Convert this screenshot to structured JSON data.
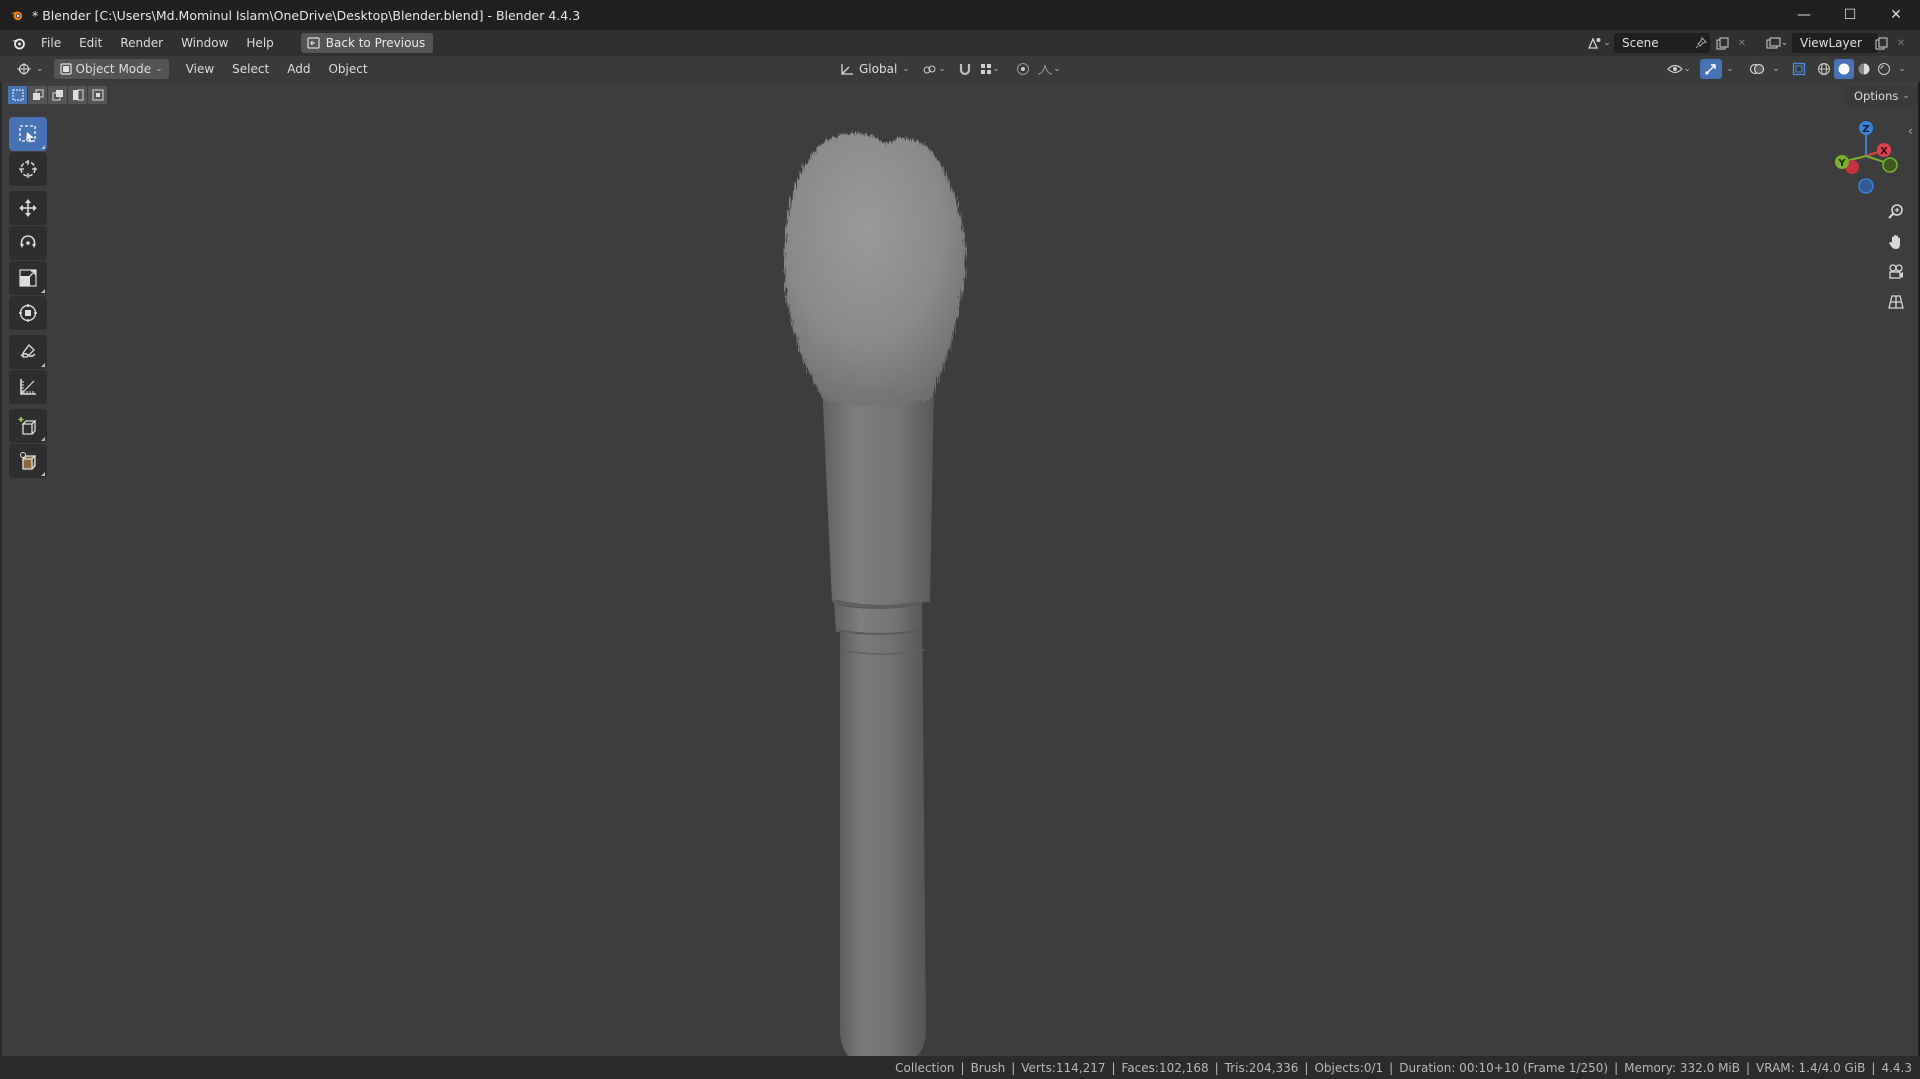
{
  "window": {
    "title": "* Blender [C:\\Users\\Md.Mominul Islam\\OneDrive\\Desktop\\Blender.blend] - Blender 4.4.3",
    "minimize": "—",
    "maximize": "☐",
    "close": "✕"
  },
  "topbar": {
    "menus": [
      "File",
      "Edit",
      "Render",
      "Window",
      "Help"
    ],
    "back_label": "Back to Previous",
    "scene_label": "Scene",
    "viewlayer_label": "ViewLayer"
  },
  "header": {
    "mode_label": "Object Mode",
    "menus": [
      "View",
      "Select",
      "Add",
      "Object"
    ],
    "orientation_label": "Global"
  },
  "viewport": {
    "options_label": "Options",
    "gizmo": {
      "z": "Z",
      "y": "Y",
      "x": "X"
    }
  },
  "statusbar": {
    "items": [
      "Collection",
      "Brush",
      "Verts:114,217",
      "Faces:102,168",
      "Tris:204,336",
      "Objects:0/1",
      "Duration: 00:10+10 (Frame 1/250)",
      "Memory: 332.0 MiB",
      "VRAM: 1.4/4.0 GiB",
      "4.4.3"
    ]
  },
  "colors": {
    "accent": "#4772b3",
    "axis_x": "#e0414d",
    "axis_y": "#7bb02c",
    "axis_z": "#3b7fd6",
    "viewport_bg": "#3d3d3d"
  }
}
